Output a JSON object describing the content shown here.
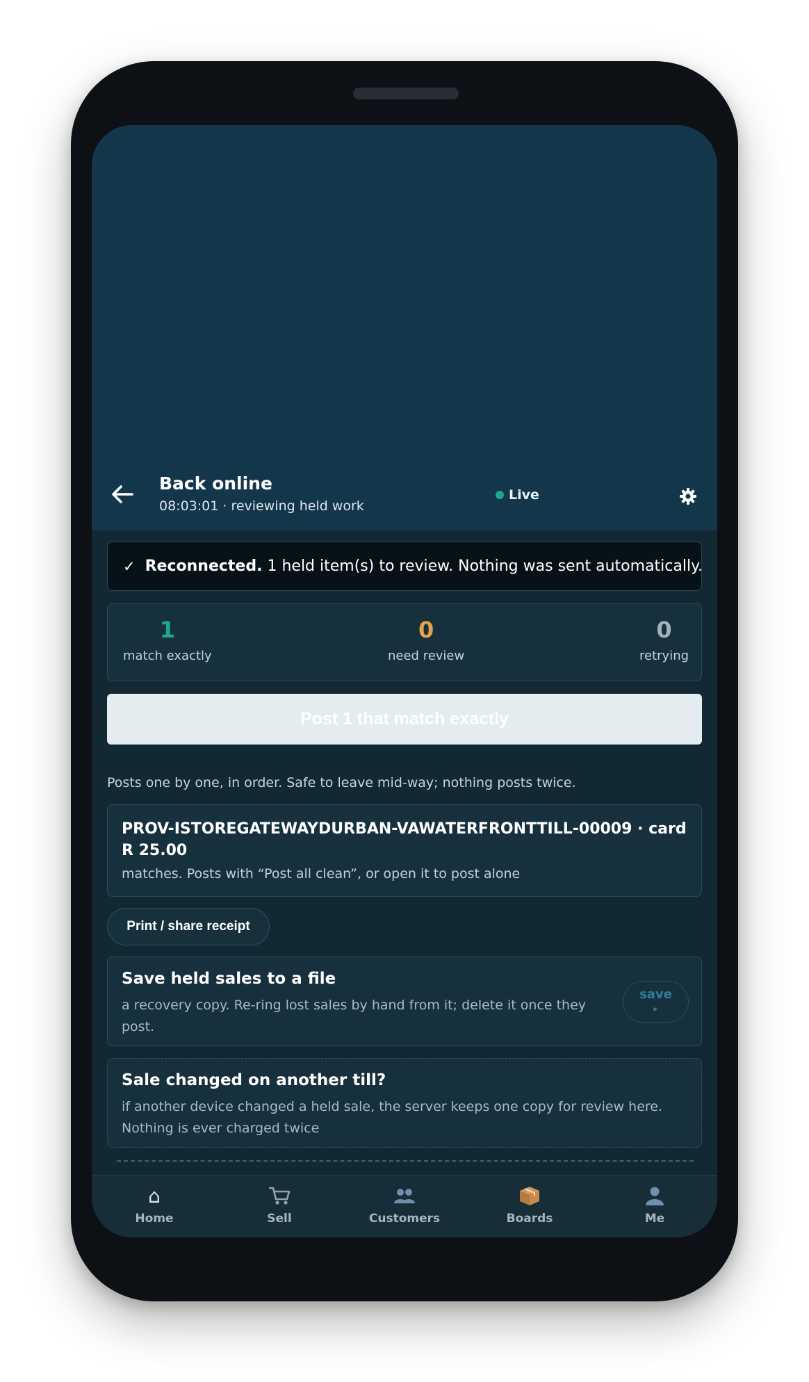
{
  "header": {
    "title": "Back online",
    "subtitle": "08:03:01 · reviewing held work",
    "live_label": "Live"
  },
  "banner": {
    "bold": "Reconnected.",
    "text": "1 held item(s) to review. Nothing was sent automatically."
  },
  "stats": [
    {
      "value": "1",
      "label": "match exactly",
      "color": "#1eaa8a"
    },
    {
      "value": "0",
      "label": "need review",
      "color": "#e4a24a"
    },
    {
      "value": "0",
      "label": "retrying",
      "color": "#a3b2ba"
    }
  ],
  "post_button": "Post 1 that match exactly",
  "hint": "Posts one by one, in order. Safe to leave mid-way; nothing posts twice.",
  "item": {
    "id": "PROV-ISTOREGATEWAYDURBAN-VAWATERFRONTTILL-00009 · card",
    "amount": "R 25.00",
    "note": "matches. Posts with “Post all clean”, or open it to post alone"
  },
  "print_button": "Print / share receipt",
  "save_card": {
    "title": "Save held sales to a file",
    "desc": "a recovery copy. Re-ring lost sales by hand from it; delete it once they post.",
    "button": "save",
    "button_arrow": "▸"
  },
  "changed_card": {
    "title": "Sale changed on another till?",
    "desc": "if another device changed a held sale, the server keeps one copy for review here. Nothing is ever charged twice"
  },
  "tabs": [
    {
      "label": "Home",
      "icon": "home-icon"
    },
    {
      "label": "Sell",
      "icon": "cart-icon"
    },
    {
      "label": "Customers",
      "icon": "people-icon"
    },
    {
      "label": "Boards",
      "icon": "package-icon"
    },
    {
      "label": "Me",
      "icon": "person-icon"
    }
  ],
  "colors": {
    "accent_live": "#19a98b",
    "header_bg": "#14364b",
    "screen_bg": "#122833"
  }
}
